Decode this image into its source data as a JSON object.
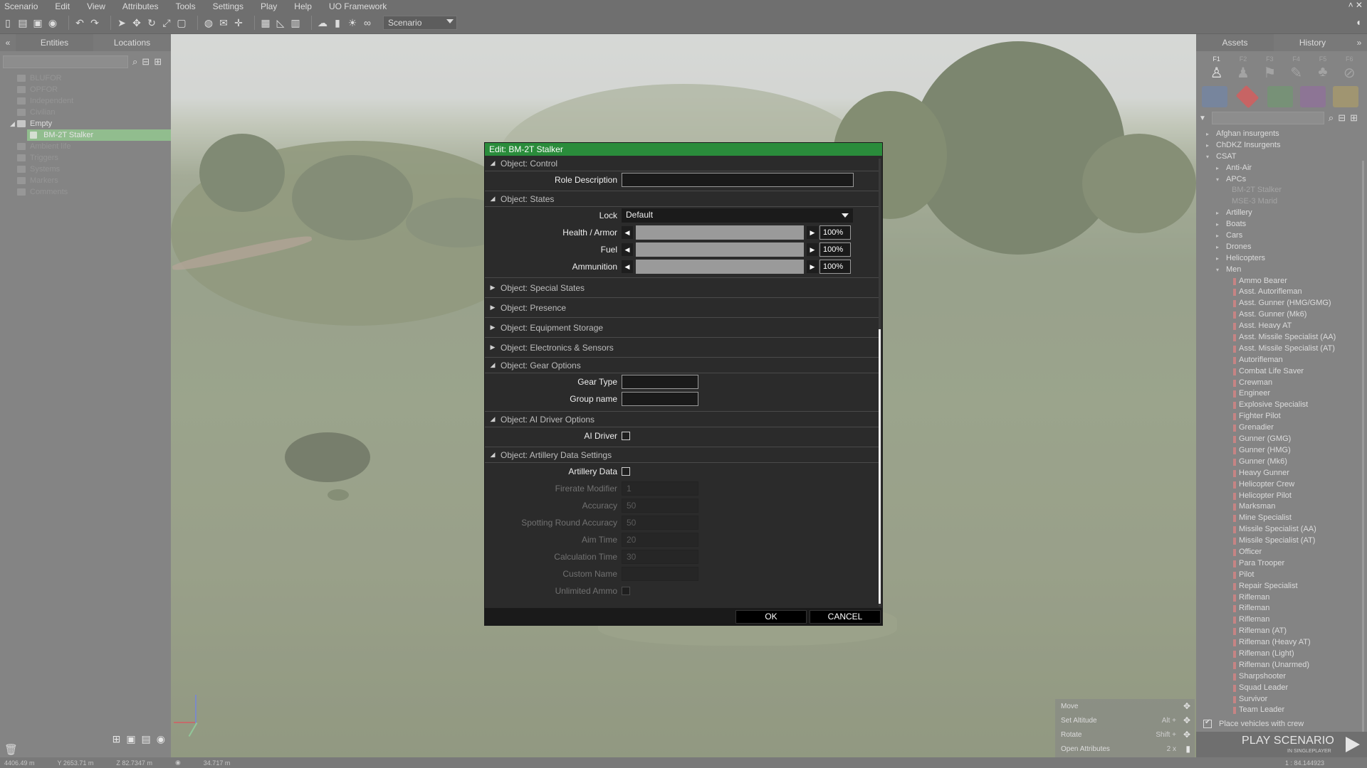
{
  "menu": [
    "Scenario",
    "Edit",
    "View",
    "Attributes",
    "Tools",
    "Settings",
    "Play",
    "Help",
    "UO Framework"
  ],
  "window_buttons": "˄  ✕",
  "toolbar": {
    "scenario_select": "Scenario",
    "icons": [
      "new-file-icon",
      "open-icon",
      "save-icon",
      "publish-icon",
      "undo-icon",
      "redo-icon",
      "select-icon",
      "move-icon",
      "rotate-icon",
      "scale-icon",
      "area-icon",
      "map-icon",
      "mail-icon",
      "compass-icon",
      "grid-icon",
      "terrain-icon",
      "vertical-icon",
      "weather-icon",
      "lights-icon",
      "sun-icon",
      "binoculars-icon"
    ]
  },
  "left_panel": {
    "tabs": [
      "Entities",
      "Locations"
    ],
    "tree": [
      {
        "label": "BLUFOR",
        "active": false
      },
      {
        "label": "OPFOR",
        "active": false
      },
      {
        "label": "Independent",
        "active": false
      },
      {
        "label": "Civilian",
        "active": false
      },
      {
        "label": "Empty",
        "active": true,
        "expanded": true
      },
      {
        "label": "BM-2T Stalker",
        "selected": true
      },
      {
        "label": "Ambient life",
        "active": false
      },
      {
        "label": "Triggers",
        "active": false
      },
      {
        "label": "Systems",
        "active": false
      },
      {
        "label": "Markers",
        "active": false
      },
      {
        "label": "Comments",
        "active": false
      }
    ]
  },
  "right_panel": {
    "tabs": [
      "Assets",
      "History"
    ],
    "fkeys": [
      "F1",
      "F2",
      "F3",
      "F4",
      "F5",
      "F6"
    ],
    "side_colors": [
      "#3f6fc0",
      "#d23a3a",
      "#3d9a3d",
      "#8a3aa6",
      "#c9a32a"
    ],
    "assets": [
      {
        "label": "Afghan insurgents",
        "level": 1,
        "arrow": "▸"
      },
      {
        "label": "ChDKZ Insurgents",
        "level": 1,
        "arrow": "▸"
      },
      {
        "label": "CSAT",
        "level": 1,
        "arrow": "▾"
      },
      {
        "label": "Anti-Air",
        "level": 2,
        "arrow": "▸"
      },
      {
        "label": "APCs",
        "level": 2,
        "arrow": "▾"
      },
      {
        "label": "BM-2T Stalker",
        "level": 3,
        "dim": true
      },
      {
        "label": "MSE-3 Marid",
        "level": 3,
        "dim": true
      },
      {
        "label": "Artillery",
        "level": 2,
        "arrow": "▸"
      },
      {
        "label": "Boats",
        "level": 2,
        "arrow": "▸"
      },
      {
        "label": "Cars",
        "level": 2,
        "arrow": "▸"
      },
      {
        "label": "Drones",
        "level": 2,
        "arrow": "▸"
      },
      {
        "label": "Helicopters",
        "level": 2,
        "arrow": "▸"
      },
      {
        "label": "Men",
        "level": 2,
        "arrow": "▾"
      },
      {
        "label": "Ammo Bearer",
        "level": 3,
        "man": true
      },
      {
        "label": "Asst. Autorifleman",
        "level": 3,
        "man": true
      },
      {
        "label": "Asst. Gunner (HMG/GMG)",
        "level": 3,
        "man": true
      },
      {
        "label": "Asst. Gunner (Mk6)",
        "level": 3,
        "man": true
      },
      {
        "label": "Asst. Heavy AT",
        "level": 3,
        "man": true
      },
      {
        "label": "Asst. Missile Specialist (AA)",
        "level": 3,
        "man": true
      },
      {
        "label": "Asst. Missile Specialist (AT)",
        "level": 3,
        "man": true
      },
      {
        "label": "Autorifleman",
        "level": 3,
        "man": true
      },
      {
        "label": "Combat Life Saver",
        "level": 3,
        "man": true
      },
      {
        "label": "Crewman",
        "level": 3,
        "man": true
      },
      {
        "label": "Engineer",
        "level": 3,
        "man": true
      },
      {
        "label": "Explosive Specialist",
        "level": 3,
        "man": true
      },
      {
        "label": "Fighter Pilot",
        "level": 3,
        "man": true
      },
      {
        "label": "Grenadier",
        "level": 3,
        "man": true
      },
      {
        "label": "Gunner (GMG)",
        "level": 3,
        "man": true
      },
      {
        "label": "Gunner (HMG)",
        "level": 3,
        "man": true
      },
      {
        "label": "Gunner (Mk6)",
        "level": 3,
        "man": true
      },
      {
        "label": "Heavy Gunner",
        "level": 3,
        "man": true
      },
      {
        "label": "Helicopter Crew",
        "level": 3,
        "man": true
      },
      {
        "label": "Helicopter Pilot",
        "level": 3,
        "man": true
      },
      {
        "label": "Marksman",
        "level": 3,
        "man": true
      },
      {
        "label": "Mine Specialist",
        "level": 3,
        "man": true
      },
      {
        "label": "Missile Specialist (AA)",
        "level": 3,
        "man": true
      },
      {
        "label": "Missile Specialist (AT)",
        "level": 3,
        "man": true
      },
      {
        "label": "Officer",
        "level": 3,
        "man": true
      },
      {
        "label": "Para Trooper",
        "level": 3,
        "man": true
      },
      {
        "label": "Pilot",
        "level": 3,
        "man": true
      },
      {
        "label": "Repair Specialist",
        "level": 3,
        "man": true
      },
      {
        "label": "Rifleman",
        "level": 3,
        "man": true
      },
      {
        "label": "Rifleman",
        "level": 3,
        "man": true
      },
      {
        "label": "Rifleman",
        "level": 3,
        "man": true
      },
      {
        "label": "Rifleman (AT)",
        "level": 3,
        "man": true
      },
      {
        "label": "Rifleman (Heavy AT)",
        "level": 3,
        "man": true
      },
      {
        "label": "Rifleman (Light)",
        "level": 3,
        "man": true
      },
      {
        "label": "Rifleman (Unarmed)",
        "level": 3,
        "man": true
      },
      {
        "label": "Sharpshooter",
        "level": 3,
        "man": true
      },
      {
        "label": "Squad Leader",
        "level": 3,
        "man": true
      },
      {
        "label": "Survivor",
        "level": 3,
        "man": true
      },
      {
        "label": "Team Leader",
        "level": 3,
        "man": true
      }
    ],
    "place_with_crew": "Place vehicles with crew",
    "play_title": "PLAY SCENARIO",
    "play_sub": "IN SINGLEPLAYER"
  },
  "hints": [
    {
      "label": "Move",
      "key": ""
    },
    {
      "label": "Set Altitude",
      "key": "Alt +"
    },
    {
      "label": "Rotate",
      "key": "Shift +"
    },
    {
      "label": "Open Attributes",
      "key": "2 x"
    }
  ],
  "status": [
    "4406.49 m",
    "Y  2653.71 m",
    "Z  82.7347 m",
    "34.717 m",
    "1 : 84.144923"
  ],
  "dialog": {
    "title": "Edit: BM-2T Stalker",
    "sections": {
      "control": "Object: Control",
      "states": "Object: States",
      "special": "Object: Special States",
      "presence": "Object: Presence",
      "equipment": "Object: Equipment Storage",
      "electronics": "Object: Electronics & Sensors",
      "gear": "Object: Gear Options",
      "ai_driver": "Object: AI Driver Options",
      "artillery": "Object: Artillery Data Settings"
    },
    "fields": {
      "role_description": "Role Description",
      "lock": "Lock",
      "lock_value": "Default",
      "health": "Health / Armor",
      "fuel": "Fuel",
      "ammunition": "Ammunition",
      "health_val": "100%",
      "fuel_val": "100%",
      "ammo_val": "100%",
      "gear_type": "Gear Type",
      "group_name": "Group name",
      "ai_driver": "AI Driver",
      "artillery_data": "Artillery Data",
      "firerate": "Firerate Modifier",
      "firerate_val": "1",
      "accuracy": "Accuracy",
      "accuracy_val": "50",
      "spotting": "Spotting Round Accuracy",
      "spotting_val": "50",
      "aim_time": "Aim Time",
      "aim_time_val": "20",
      "calc_time": "Calculation Time",
      "calc_time_val": "30",
      "custom_name": "Custom Name",
      "unlimited_ammo": "Unlimited Ammo"
    },
    "ok": "OK",
    "cancel": "CANCEL"
  }
}
